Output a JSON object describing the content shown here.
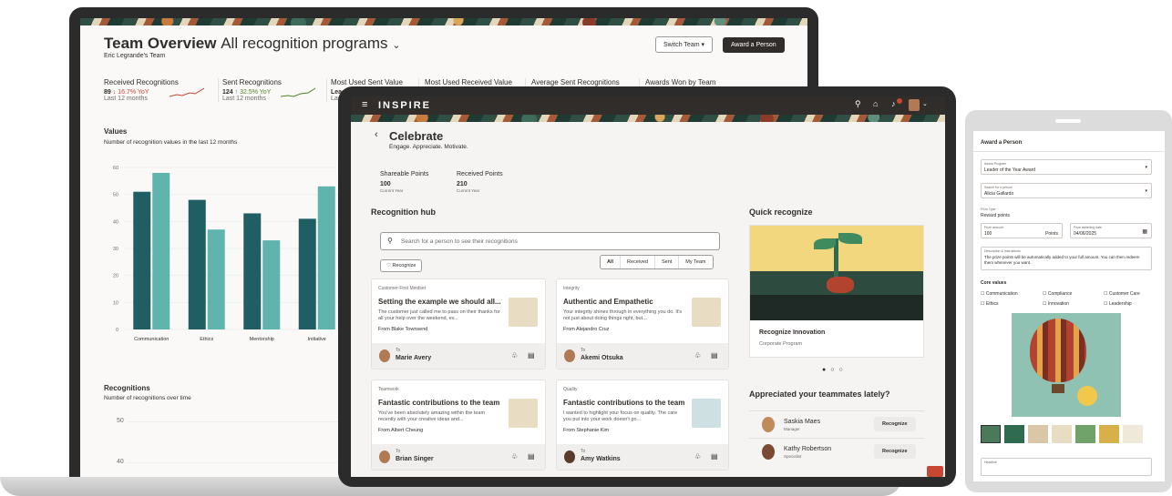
{
  "dashboard": {
    "title_bold": "Team Overview",
    "title_rest": "All recognition programs",
    "subtitle": "Eric Legrande's Team",
    "switch_team": "Switch Team",
    "award_button": "Award a Person",
    "metrics": [
      {
        "label": "Received Recognitions",
        "value": "89",
        "delta": "↓ 16.7% YoY",
        "period": "Last 12 months"
      },
      {
        "label": "Sent Recognitions",
        "value": "124",
        "delta": "↑ 32.5% YoY",
        "period": "Last 12 months"
      },
      {
        "label": "Most Used Sent Value",
        "value": "Lea",
        "delta": "",
        "period": "Las"
      },
      {
        "label": "Most Used Received Value",
        "value": "",
        "delta": "",
        "period": ""
      },
      {
        "label": "Average Sent Recognitions",
        "value": "",
        "delta": "",
        "period": ""
      },
      {
        "label": "Awards Won by Team",
        "value": "",
        "delta": "",
        "period": ""
      }
    ],
    "values_title": "Values",
    "values_sub": "Number of recognition values in the last 12 months",
    "recognitions_title": "Recognitions",
    "recognitions_sub": "Number of recognitions over time",
    "recog_ticks": [
      "50",
      "40"
    ]
  },
  "chart_data": {
    "type": "bar",
    "categories": [
      "Communication",
      "Ethics",
      "Mentorship",
      "Initiative"
    ],
    "series": [
      {
        "values": [
          51,
          48,
          43,
          41
        ]
      },
      {
        "values": [
          58,
          37,
          33,
          53
        ]
      }
    ],
    "ylim": [
      0,
      60
    ],
    "yticks": [
      "0",
      "10",
      "20",
      "30",
      "40",
      "50",
      "60"
    ],
    "colors": [
      "#1f5f63",
      "#5fb5ad"
    ]
  },
  "app": {
    "brand": "INSPIRE",
    "page_title": "Celebrate",
    "page_sub": "Engage. Appreciate. Motivate.",
    "points": [
      {
        "label": "Shareable Points",
        "value": "100",
        "period": "Current Year"
      },
      {
        "label": "Received Points",
        "value": "210",
        "period": "Current Year"
      }
    ],
    "hub_title": "Recognition hub",
    "search_placeholder": "Search for a person to see their recognitions",
    "recognize_btn": "Recognize",
    "filters": [
      "All",
      "Received",
      "Sent",
      "My Team"
    ],
    "cards": [
      {
        "cat": "Customer-First Mindset",
        "title": "Setting the example we should all...",
        "body": "The customer just called me to pass on their thanks for all your help over the weekend, ev...",
        "from": "From Blake Townsend",
        "to_label": "To",
        "to": "Marie Avery"
      },
      {
        "cat": "Integrity",
        "title": "Authentic and Empathetic",
        "body": "Your integrity shines through in everything you do. It's not just about doing things right, but...",
        "from": "From Alejandro Cruz",
        "to_label": "To",
        "to": "Akemi Otsuka"
      },
      {
        "cat": "Teamwork",
        "title": "Fantastic contributions to the team",
        "body": "You've been absolutely amazing within the team recently with your creative ideas and...",
        "from": "From Albert Cheung",
        "to_label": "To",
        "to": "Brian Singer"
      },
      {
        "cat": "Quality",
        "title": "Fantastic contributions to the team",
        "body": "I wanted to highlight your focus on quality. The care you put into your work doesn't go...",
        "from": "From Stephanie Kim",
        "to_label": "To",
        "to": "Amy Watkins"
      }
    ],
    "quick_title": "Quick recognize",
    "quick_card_title": "Recognize Innovation",
    "quick_card_sub": "Corporate Program",
    "appreciated_title": "Appreciated your teammates lately?",
    "teammates": [
      {
        "name": "Saskia Maes",
        "role": "Manager",
        "action": "Recognize"
      },
      {
        "name": "Kathy Robertson",
        "role": "Specialist",
        "action": "Recognize"
      }
    ]
  },
  "award_form": {
    "title": "Award a Person",
    "program_label": "Award Program",
    "program_value": "Leader of the Year Award",
    "person_label": "Search for a person",
    "person_value": "Alicia Gallardo",
    "prize_type_label": "Prize Type",
    "prize_type_value": "Reward points",
    "amount_label": "Prize amount",
    "amount_value": "100",
    "amount_unit": "Points",
    "date_label": "Prize awarding date",
    "date_value": "04/06/2025",
    "desc_label": "Description & Instructions",
    "desc_value": "The prize points will be automatically added to your full amount. You can then redeem them whenever you want.",
    "core_values_label": "Core values",
    "core_values": [
      "Communication",
      "Compliance",
      "Customer Care",
      "Ethics",
      "Innovation",
      "Leadership"
    ],
    "headline_label": "Headline"
  }
}
